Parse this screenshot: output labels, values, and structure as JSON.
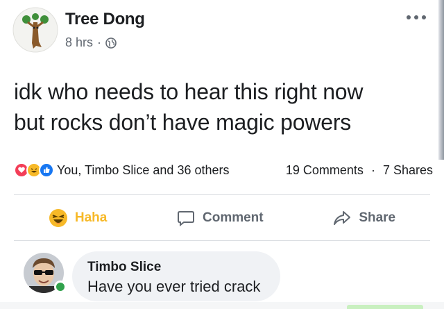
{
  "post": {
    "author": "Tree Dong",
    "time": "8 hrs",
    "privacy_icon": "globe-icon",
    "text_line1": "idk who needs to hear this right now",
    "text_line2": "but rocks don’t have magic powers"
  },
  "reactions": {
    "icons": [
      "love-reaction",
      "haha-reaction",
      "like-reaction"
    ],
    "summary": "You, Timbo Slice and 36 others",
    "comments": "19 Comments",
    "shares": "7 Shares"
  },
  "actions": {
    "haha_label": "Haha",
    "comment_label": "Comment",
    "share_label": "Share"
  },
  "comment": {
    "author": "Timbo Slice",
    "text": "Have you ever tried crack"
  },
  "colors": {
    "haha": "#f7b928",
    "love": "#f33e58",
    "like": "#1877f2",
    "online": "#31a24c",
    "bubble": "#f0f2f5"
  }
}
